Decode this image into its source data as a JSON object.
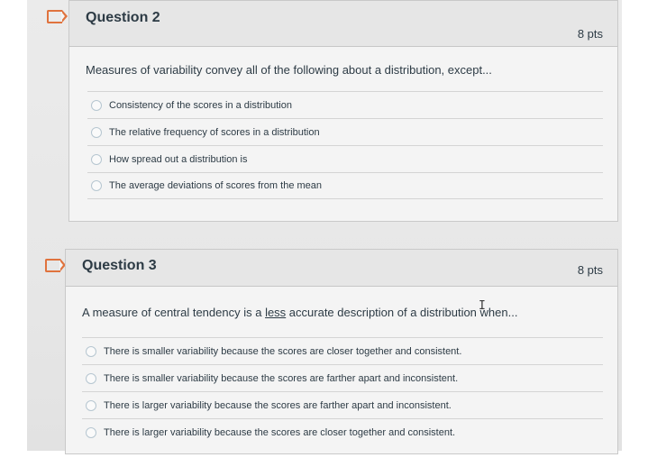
{
  "question2": {
    "title": "Question 2",
    "points": "8 pts",
    "prompt": "Measures of variability convey all of the following about a distribution, except...",
    "answers": [
      "Consistency of the scores in a distribution",
      "The relative frequency of scores in a distribution",
      "How spread out a distribution is",
      "The average deviations of scores from the mean"
    ]
  },
  "question3": {
    "title": "Question 3",
    "points": "8 pts",
    "prompt_before": "A measure of central tendency is a ",
    "prompt_emphasis": "less",
    "prompt_after": " accurate description of a distribution when...",
    "answers": [
      "There is smaller variability because the scores are closer together and consistent.",
      "There is smaller variability because the scores are farther apart and inconsistent.",
      "There is larger variability because the scores are farther apart and inconsistent.",
      "There is larger variability because the scores are closer together and consistent."
    ]
  },
  "colors": {
    "flag": "#e0733e",
    "header_bg": "#e6e6e6",
    "card_bg": "#f4f4f4",
    "text": "#2d3b45",
    "radio_border": "#b6c6d0"
  },
  "icons": {
    "flag": "flag-icon",
    "radio": "radio-icon",
    "cursor": "text-cursor-icon"
  }
}
